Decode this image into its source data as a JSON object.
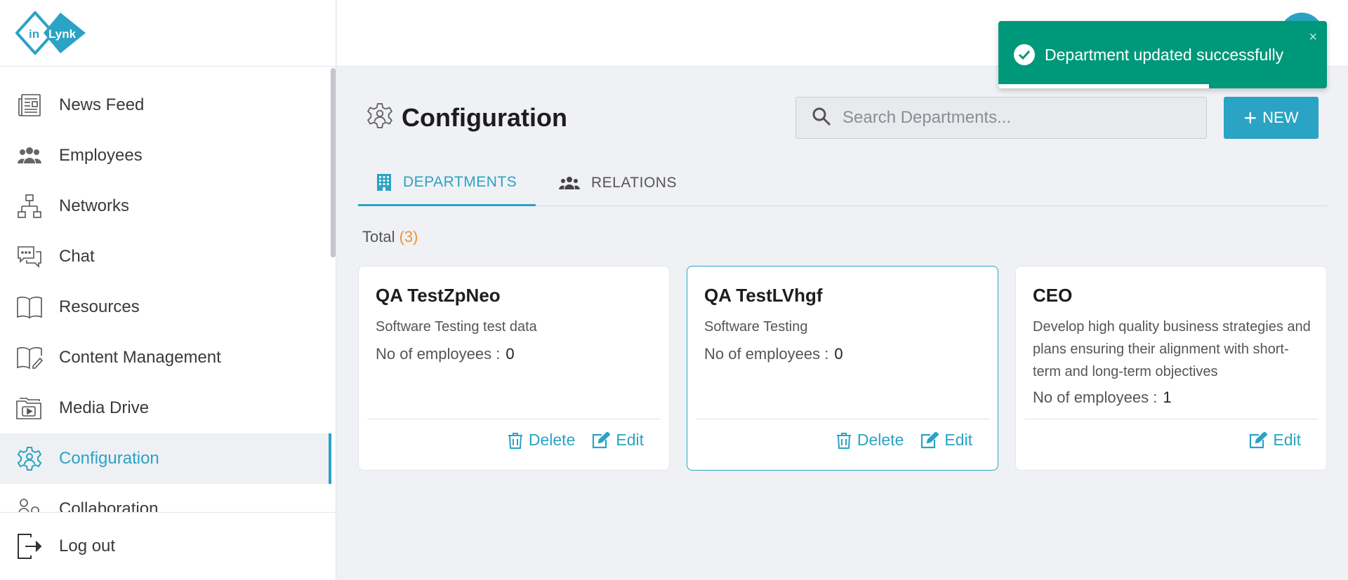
{
  "app": {
    "logo_text": "inLynk"
  },
  "sidebar": {
    "items": [
      {
        "label": "News Feed",
        "icon": "newspaper-icon"
      },
      {
        "label": "Employees",
        "icon": "people-icon"
      },
      {
        "label": "Networks",
        "icon": "network-icon"
      },
      {
        "label": "Chat",
        "icon": "chat-icon"
      },
      {
        "label": "Resources",
        "icon": "book-icon"
      },
      {
        "label": "Content Management",
        "icon": "book-edit-icon"
      },
      {
        "label": "Media Drive",
        "icon": "folder-media-icon"
      },
      {
        "label": "Configuration",
        "icon": "gear-icon",
        "active": true
      },
      {
        "label": "Collaboration",
        "icon": "collaboration-icon"
      }
    ],
    "logout_label": "Log out"
  },
  "header": {
    "title": "Configuration",
    "search_placeholder": "Search Departments...",
    "new_label": "NEW"
  },
  "tabs": [
    {
      "label": "DEPARTMENTS",
      "active": true
    },
    {
      "label": "RELATIONS",
      "active": false
    }
  ],
  "total": {
    "label": "Total",
    "count": "(3)"
  },
  "cards": [
    {
      "name": "QA TestZpNeo",
      "description": "Software Testing test data",
      "employees_label": "No of employees :",
      "employees": "0",
      "delete_label": "Delete",
      "edit_label": "Edit"
    },
    {
      "name": "QA TestLVhgf",
      "description": "Software Testing",
      "employees_label": "No of employees :",
      "employees": "0",
      "delete_label": "Delete",
      "edit_label": "Edit"
    },
    {
      "name": "CEO",
      "description": "Develop high quality business strategies and plans ensuring their alignment with short-term and long-term objectives",
      "employees_label": "No of employees :",
      "employees": "1",
      "edit_label": "Edit"
    }
  ],
  "toast": {
    "message": "Department updated successfully",
    "close": "×",
    "progress_fraction": 0.64
  },
  "colors": {
    "accent": "#2aa3c4",
    "toast": "#00987a",
    "total_count": "#e8953a"
  }
}
